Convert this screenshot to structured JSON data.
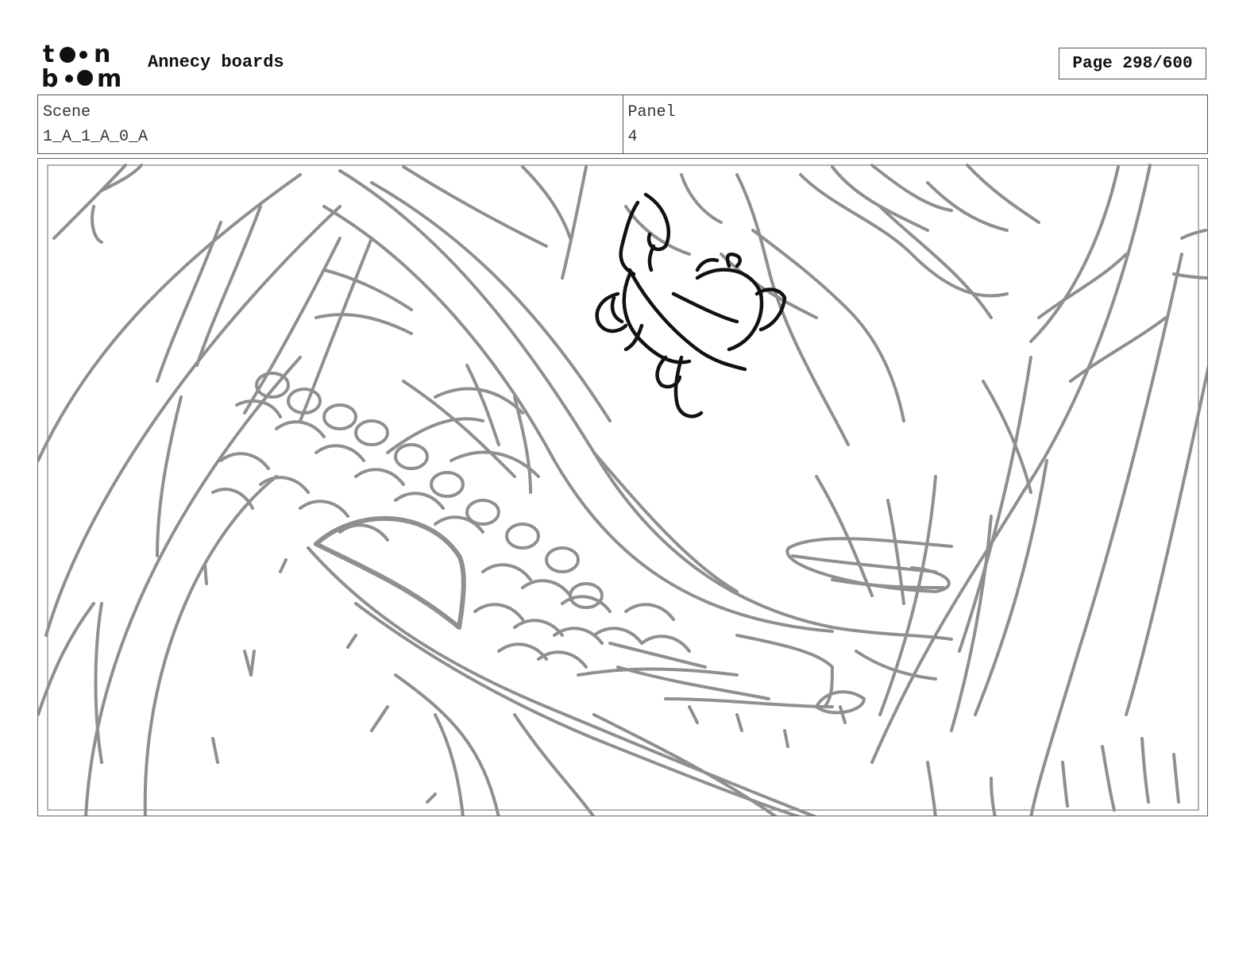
{
  "header": {
    "logo_text": "toon boom",
    "project_title": "Annecy boards",
    "page_indicator": "Page 298/600"
  },
  "info": {
    "scene_label": "Scene",
    "scene_value": "1_A_1_A_0_A",
    "panel_label": "Panel",
    "panel_value": "4"
  },
  "colors": {
    "sketch_gray": "#8f8f8f",
    "character_ink": "#111111",
    "frame_border": "#555555"
  }
}
